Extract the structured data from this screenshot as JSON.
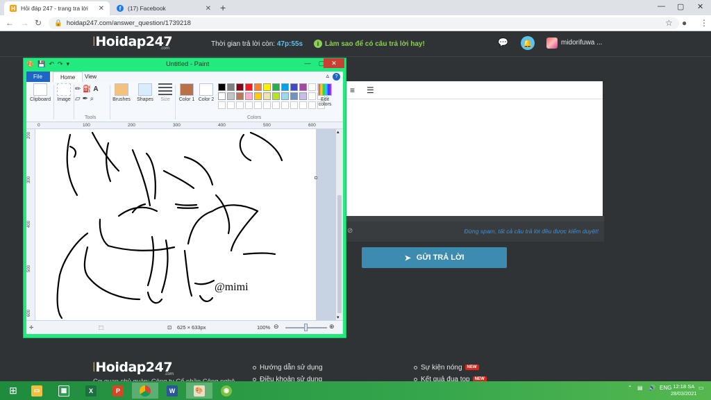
{
  "browser": {
    "tabs": [
      {
        "title": "Hỏi đáp 247 - trang tra lời",
        "icon": "hoidap-favicon"
      },
      {
        "title": "(17) Facebook",
        "icon": "facebook-favicon"
      }
    ],
    "url": "hoidap247.com/answer_question/1739218"
  },
  "site": {
    "logo_text": "Hoidap247",
    "logo_suffix": ".com",
    "timer_label": "Thời gian trả lời còn:",
    "timer_value": "47p:55s",
    "tip_label": "Làm sao để có câu trả lời hay!",
    "username": "midorifuwa ...",
    "notice": "Đừng spam, tất cả câu trả lời đều được kiểm duyệt!",
    "submit_label": "GỬI TRẢ LỜI",
    "colors": {
      "bg": "#2f3335",
      "accent": "#5dc3ec",
      "tip": "#8bd04f",
      "button": "#3d8cb0",
      "notice": "#3f8fd6"
    }
  },
  "footer": {
    "col1": [
      "Hướng dẫn sử dụng",
      "Điều khoản sử dụng"
    ],
    "col2": [
      "Sự kiện nóng",
      "Kết quả đua top"
    ],
    "badge": "NEW",
    "org": "Cơ quan chủ quản: Công ty Cổ phần Công nghệ"
  },
  "paint": {
    "title": "Untitled - Paint",
    "tabs": [
      "File",
      "Home",
      "View"
    ],
    "groups": {
      "clipboard": "Clipboard",
      "image": "Image",
      "tools": "Tools",
      "brushes": "Brushes",
      "shapes": "Shapes",
      "size": "Size",
      "color1": "Color 1",
      "color2": "Color 2",
      "colors": "Colors",
      "edit_colors": "Edit colors"
    },
    "color1": "#b9714a",
    "color2": "#ffffff",
    "palette_row1": [
      "#000000",
      "#7f7f7f",
      "#880015",
      "#ed1c24",
      "#ff7f27",
      "#fff200",
      "#22b14c",
      "#00a2e8",
      "#3f48cc",
      "#a349a4"
    ],
    "palette_row2": [
      "#ffffff",
      "#c3c3c3",
      "#b97a57",
      "#ffaec9",
      "#ffc90e",
      "#efe4b0",
      "#b5e61d",
      "#99d9ea",
      "#7092be",
      "#c8bfe7"
    ],
    "ruler_h": [
      "0",
      "100",
      "200",
      "300",
      "400",
      "500",
      "600"
    ],
    "ruler_v": [
      "200",
      "300",
      "400",
      "500",
      "600"
    ],
    "signature": "@mimi",
    "canvas_size": "625 × 633px",
    "zoom": "100%"
  },
  "taskbar": {
    "apps": [
      "file-explorer",
      "excel",
      "powerpoint",
      "chrome",
      "word",
      "paint",
      "coccoc"
    ],
    "language": "ENG",
    "time": "12:18 SA",
    "date": "28/03/2021"
  }
}
